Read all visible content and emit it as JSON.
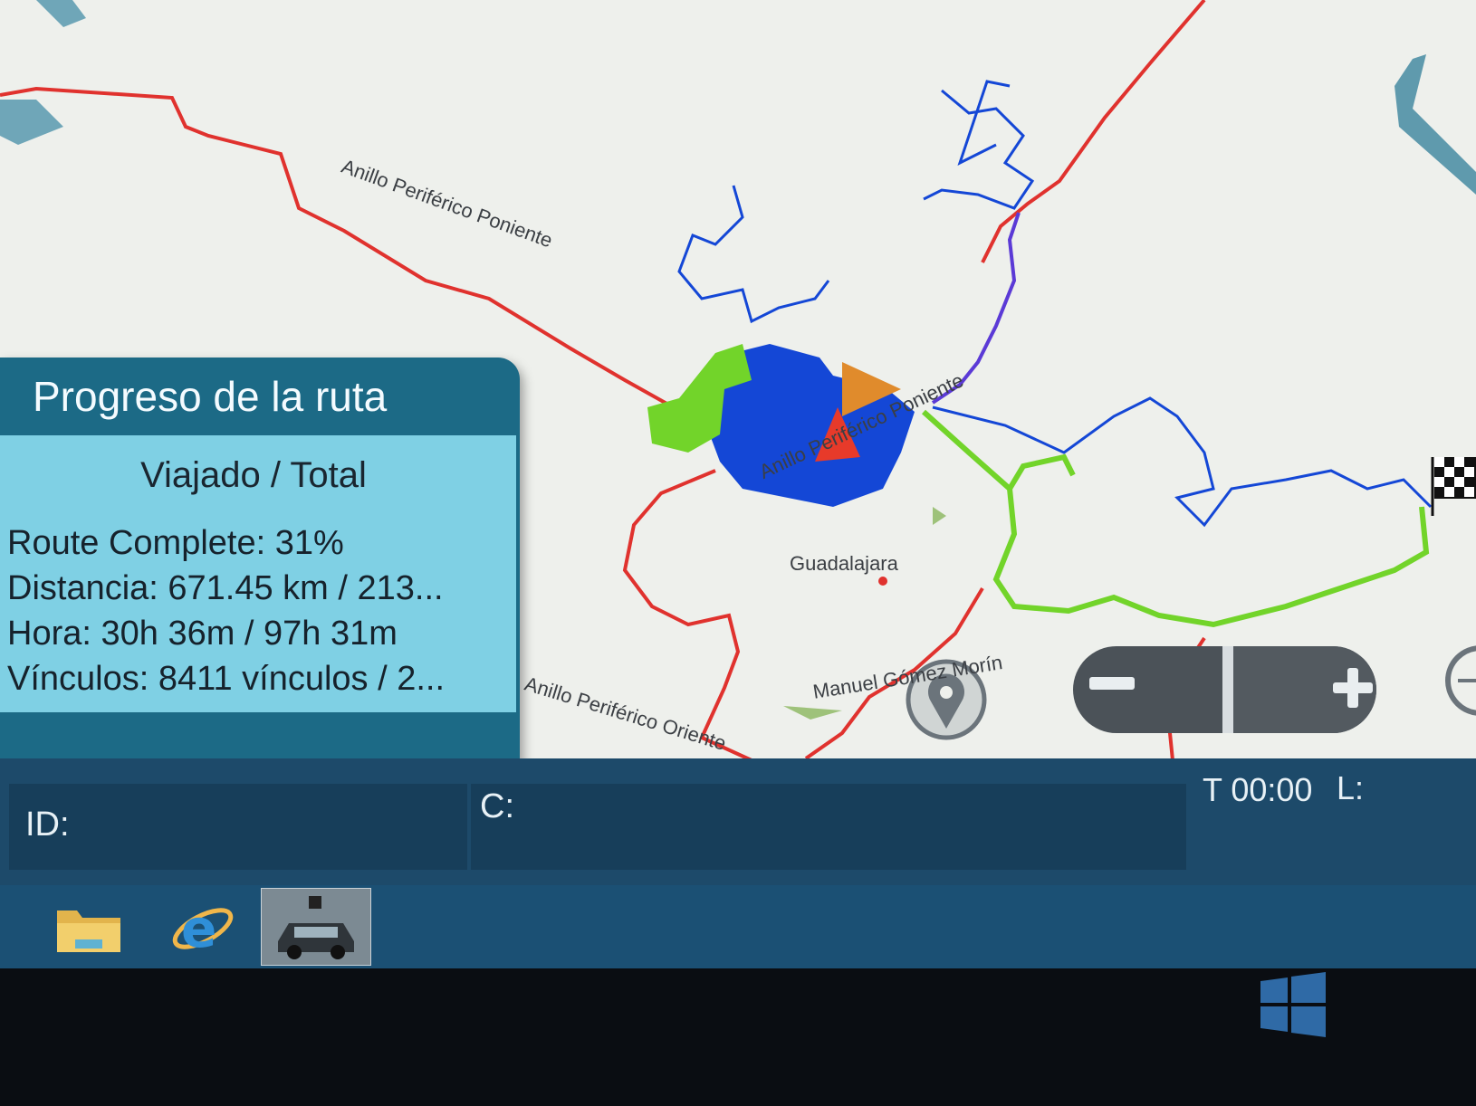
{
  "map": {
    "road_labels": [
      "Anillo Periférico Poniente",
      "Anillo Periférico Oriente",
      "Manuel Gómez Morín",
      "Anillo Periférico Poniente"
    ],
    "city_label": "Guadalajara",
    "colors": {
      "background": "#eef0ec",
      "main_road": "#e0322e",
      "traveled_route": "#1447d6",
      "pending_route": "#72d42a",
      "vehicle_marker": "#e73a2a",
      "destination_marker": "#e08b2c"
    }
  },
  "panel": {
    "title": "Progreso de la ruta",
    "subtitle": "Viajado / Total",
    "route_complete": "Route Complete: 31%",
    "distance": "Distancia: 671.45 km / 213...",
    "time": "Hora: 30h 36m / 97h 31m",
    "links": "Vínculos: 8411 vínculos / 2..."
  },
  "zoom": {
    "out_label": "−",
    "in_label": "+"
  },
  "status_bar": {
    "id_label": "ID:",
    "c_label": "C:",
    "time_label": "T 00:00",
    "l_label": "L:"
  },
  "taskbar": {
    "icons": [
      "folder-icon",
      "internet-explorer-icon",
      "car-app-icon"
    ]
  },
  "icons": {
    "finish": "checkered-flag-icon",
    "location": "location-pin-icon",
    "compass": "compass-icon",
    "windows": "windows-logo-icon"
  }
}
